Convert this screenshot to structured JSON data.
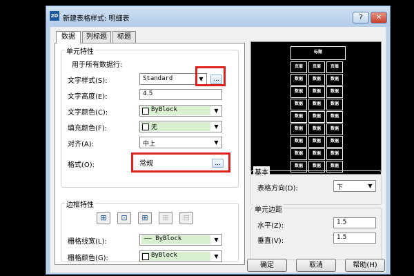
{
  "window": {
    "title": "新建表格样式: 明细表",
    "app_icon": "2D",
    "help_label": "?",
    "close_label": "✕"
  },
  "tabs": [
    "数据",
    "列标题",
    "标题"
  ],
  "cell_props": {
    "group_title": "单元特性",
    "subtitle": "用于所有数据行:",
    "text_style": {
      "label": "文字样式(S):",
      "value": "Standard"
    },
    "text_height": {
      "label": "文字高度(E):",
      "value": "4.5"
    },
    "text_color": {
      "label": "文字颜色(C):",
      "value": "ByBlock"
    },
    "fill_color": {
      "label": "填充颜色(F):",
      "value": "无"
    },
    "align": {
      "label": "对齐(A):",
      "value": "中上"
    },
    "format": {
      "label": "格式(O):",
      "value": "常规"
    },
    "ellipsis": "..."
  },
  "border_props": {
    "group_title": "边框特性",
    "buttons": [
      "⊞",
      "⊡",
      "⊞",
      "⊞",
      "⊟"
    ],
    "line_weight": {
      "label": "栅格线宽(L):",
      "value": "—— ByBlock"
    },
    "line_color": {
      "label": "栅格颜色(G):",
      "value": "ByBlock"
    }
  },
  "preview": {
    "header": "标题",
    "col_header": "页眉",
    "cell_text": "数据",
    "rows": 9,
    "cols": 3
  },
  "general": {
    "group_title": "基本",
    "direction": {
      "label": "表格方向(D):",
      "value": "下"
    }
  },
  "margins": {
    "group_title": "单元边距",
    "horizontal": {
      "label": "水平(Z):",
      "value": "1.5"
    },
    "vertical": {
      "label": "垂直(V):",
      "value": "1.5"
    }
  },
  "buttons": {
    "ok": "确定",
    "cancel": "取消",
    "help": "帮助(H)"
  },
  "colors": {
    "title_bar": "#bcd3ea",
    "highlight": "#e0201c",
    "bylayer_fill": "#d8f0d0"
  }
}
